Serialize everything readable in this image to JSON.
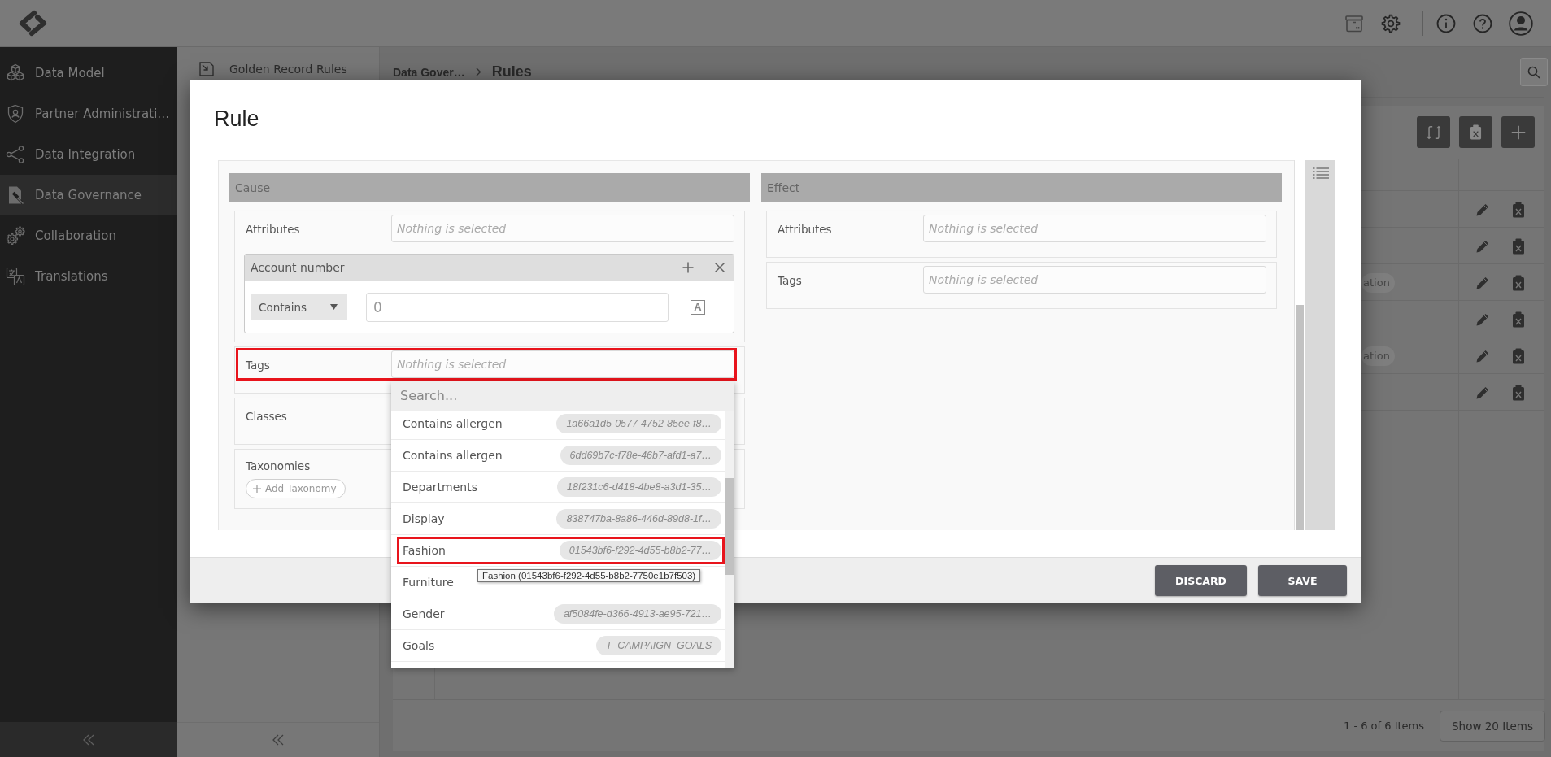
{
  "sidebar": {
    "items": [
      {
        "label": "Data Model",
        "selected": false
      },
      {
        "label": "Partner Administrati…",
        "selected": false
      },
      {
        "label": "Data Integration",
        "selected": false
      },
      {
        "label": "Data Governance",
        "selected": true
      },
      {
        "label": "Collaboration",
        "selected": false
      },
      {
        "label": "Translations",
        "selected": false
      }
    ]
  },
  "rules_panel": {
    "items": [
      {
        "label": "Golden Record Rules"
      }
    ]
  },
  "breadcrumb": [
    "Data Gover…",
    "Rules"
  ],
  "table": {
    "rows": [
      {},
      {},
      {
        "tag": "ation"
      },
      {},
      {
        "tag": "ation"
      },
      {}
    ]
  },
  "pagination": {
    "summary": "1 - 6 of 6 Items",
    "page_size_button": "Show 20 Items"
  },
  "modal": {
    "title": "Rule",
    "cause": {
      "heading": "Cause",
      "sections": [
        {
          "kind": "picker",
          "label": "Attributes",
          "placeholder": "Nothing is selected",
          "highlighted": false,
          "conditions": [
            {
              "attribute": "Account number",
              "operator": "Contains",
              "value": "0",
              "type_icon": "A"
            }
          ]
        },
        {
          "kind": "picker",
          "label": "Tags",
          "placeholder": "Nothing is selected",
          "highlighted": true,
          "dropdown": {
            "search_placeholder": "Search...",
            "items": [
              {
                "label": "Contains allergen",
                "id": "1a66a1d5-0577-4752-85ee-f8…",
                "highlighted": false
              },
              {
                "label": "Contains allergen",
                "id": "6dd69b7c-f78e-46b7-afd1-a7…",
                "highlighted": false
              },
              {
                "label": "Departments",
                "id": "18f231c6-d418-4be8-a3d1-35…",
                "highlighted": false
              },
              {
                "label": "Display",
                "id": "838747ba-8a86-446d-89d8-1f…",
                "highlighted": false
              },
              {
                "label": "Fashion",
                "id": "01543bf6-f292-4d55-b8b2-77…",
                "highlighted": true
              },
              {
                "label": "Furniture",
                "highlighted": false
              },
              {
                "label": "Gender",
                "id": "af5084fe-d366-4913-ae95-721…",
                "highlighted": false
              },
              {
                "label": "Goals",
                "id": "T_CAMPAIGN_GOALS",
                "highlighted": false
              }
            ],
            "tooltip": "Fashion (01543bf6-f292-4d55-b8b2-7750e1b7f503)"
          }
        },
        {
          "kind": "picker",
          "label": "Classes",
          "highlighted": false
        },
        {
          "kind": "taxonomy",
          "label": "Taxonomies",
          "button": "Add Taxonomy",
          "highlighted": false
        }
      ]
    },
    "effect": {
      "heading": "Effect",
      "sections": [
        {
          "kind": "picker",
          "label": "Attributes",
          "placeholder": "Nothing is selected",
          "highlighted": false
        },
        {
          "kind": "picker",
          "label": "Tags",
          "placeholder": "Nothing is selected",
          "highlighted": false
        }
      ]
    },
    "buttons": [
      "DISCARD",
      "SAVE"
    ]
  }
}
